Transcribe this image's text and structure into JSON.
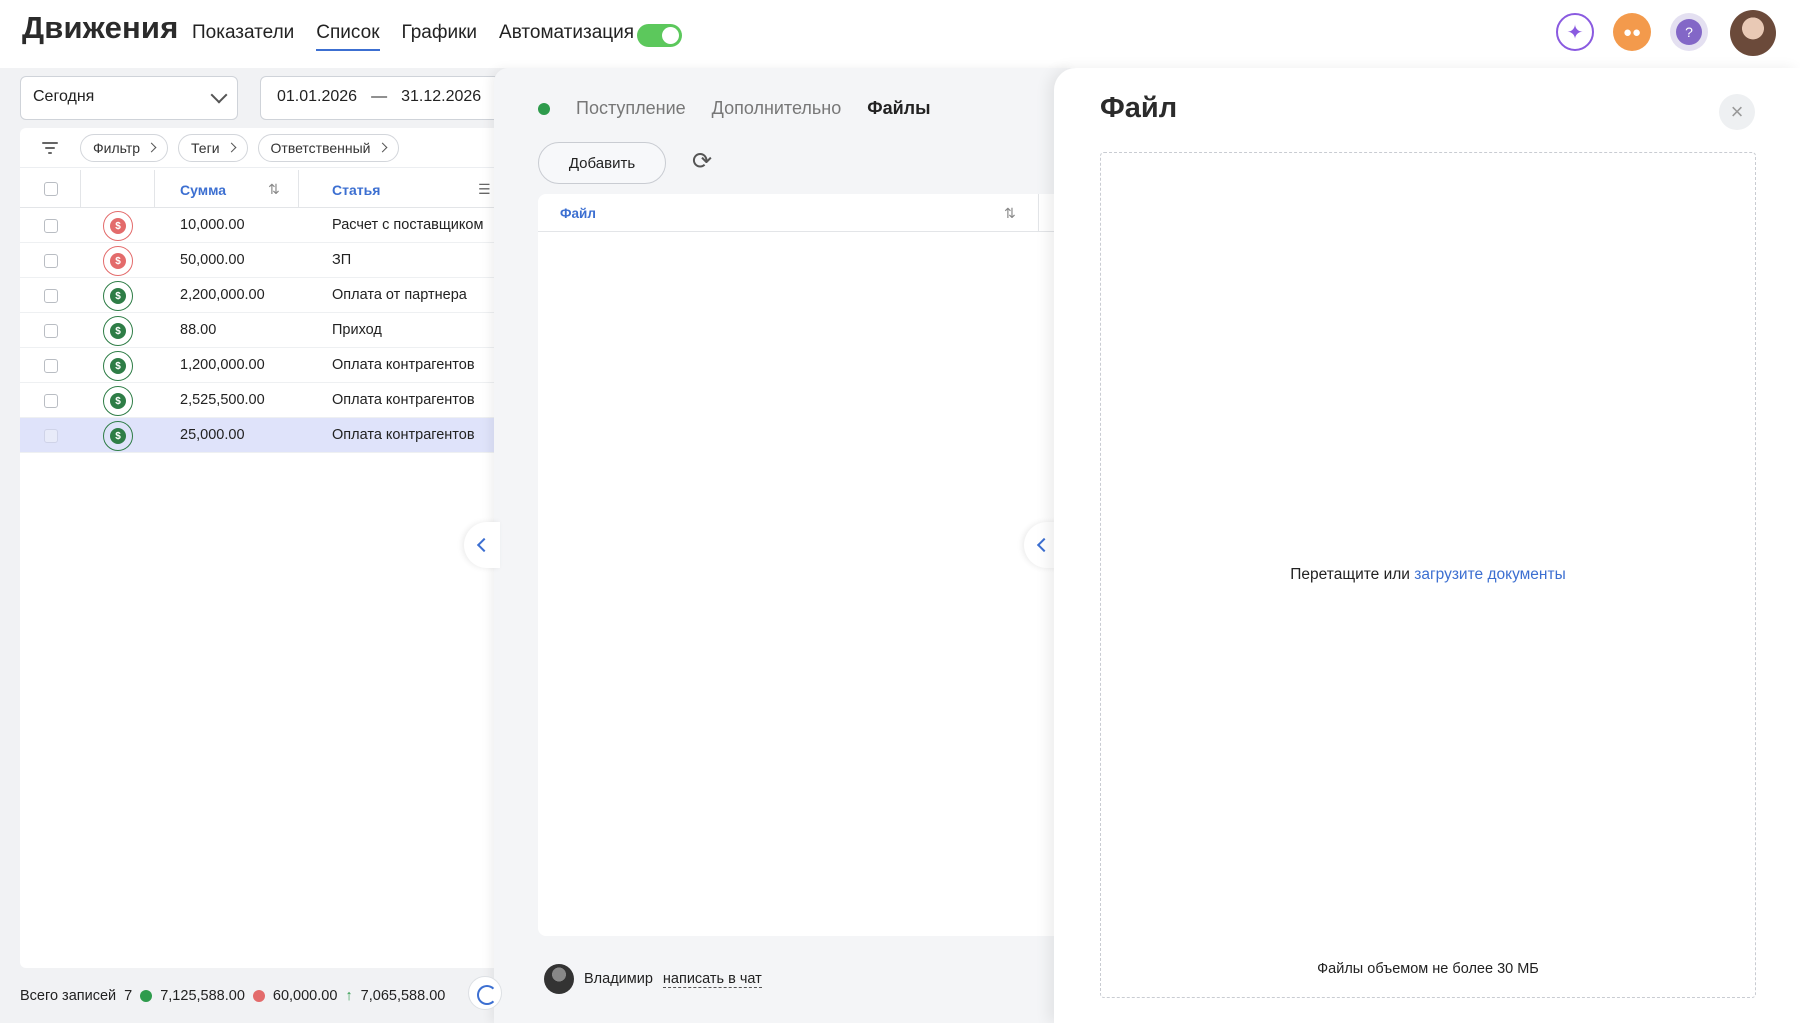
{
  "header": {
    "title": "Движения",
    "nav": [
      "Показатели",
      "Список",
      "Графики",
      "Автоматизация"
    ],
    "active_nav": "Список",
    "toggle_on": true,
    "icons": [
      "sparkle-icon",
      "chat-icon",
      "help-icon",
      "user-avatar"
    ],
    "help_glyph": "?"
  },
  "list": {
    "period": "Сегодня",
    "date_from": "01.01.2026",
    "date_sep": "—",
    "date_to": "31.12.2026",
    "filters": [
      "Фильтр",
      "Теги",
      "Ответственный"
    ],
    "columns": {
      "sum": "Сумма",
      "article": "Статья"
    },
    "rows": [
      {
        "type": "out",
        "sum": "10,000.00",
        "article": "Расчет с поставщиком"
      },
      {
        "type": "out",
        "sum": "50,000.00",
        "article": "ЗП"
      },
      {
        "type": "in",
        "sum": "2,200,000.00",
        "article": "Оплата от партнера"
      },
      {
        "type": "in",
        "sum": "88.00",
        "article": "Приход"
      },
      {
        "type": "in",
        "sum": "1,200,000.00",
        "article": "Оплата контрагентов"
      },
      {
        "type": "in",
        "sum": "2,525,500.00",
        "article": "Оплата контрагентов"
      },
      {
        "type": "in",
        "sum": "25,000.00",
        "article": "Оплата контрагентов",
        "selected": true
      }
    ],
    "totals": {
      "label": "Всего записей",
      "count": "7",
      "income": "7,125,588.00",
      "expense": "60,000.00",
      "balance": "7,065,588.00"
    }
  },
  "operation": {
    "tabs": [
      "Поступление",
      "Дополнительно",
      "Файлы"
    ],
    "active_tab": "Файлы",
    "add_button": "Добавить",
    "files_column": "Файл",
    "footer_name": "Владимир",
    "footer_link": "написать в чат"
  },
  "file_panel": {
    "title": "Файл",
    "drop_text": "Перетащите или",
    "drop_link": "загрузите документы",
    "limit": "Файлы объемом не более 30 МБ"
  },
  "colors": {
    "accent": "#3c6fd1",
    "income": "#2e9b4c",
    "expense": "#e36b6b",
    "toggle": "#5cc85c"
  }
}
